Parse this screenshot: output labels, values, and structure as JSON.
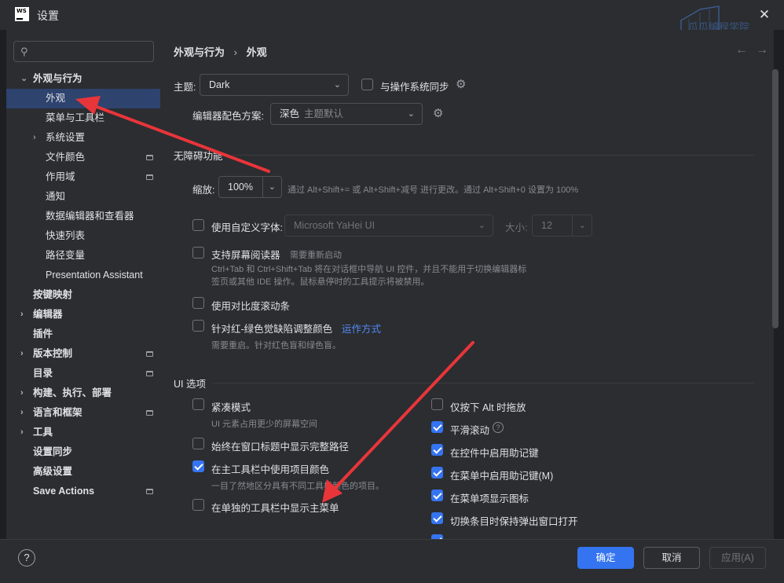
{
  "window": {
    "title": "设置",
    "logo_text": "WS",
    "watermark": "瓜瓜编程学院"
  },
  "sidebar": {
    "search_placeholder": "",
    "items": [
      {
        "label": "外观与行为",
        "expanded": true
      },
      {
        "label": "外观",
        "selected": true
      },
      {
        "label": "菜单与工具栏"
      },
      {
        "label": "系统设置"
      },
      {
        "label": "文件颜色"
      },
      {
        "label": "作用域"
      },
      {
        "label": "通知"
      },
      {
        "label": "数据编辑器和查看器"
      },
      {
        "label": "快速列表"
      },
      {
        "label": "路径变量"
      },
      {
        "label": "Presentation Assistant"
      },
      {
        "label": "按键映射"
      },
      {
        "label": "编辑器"
      },
      {
        "label": "插件"
      },
      {
        "label": "版本控制"
      },
      {
        "label": "目录"
      },
      {
        "label": "构建、执行、部署"
      },
      {
        "label": "语言和框架"
      },
      {
        "label": "工具"
      },
      {
        "label": "设置同步"
      },
      {
        "label": "高级设置"
      },
      {
        "label": "Save Actions"
      }
    ]
  },
  "breadcrumb": {
    "parent": "外观与行为",
    "separator": "›",
    "current": "外观"
  },
  "nav": {
    "back": "←",
    "forward": "→"
  },
  "theme": {
    "label": "主题:",
    "value": "Dark",
    "sync_label": "与操作系统同步",
    "sync_checked": false
  },
  "scheme": {
    "label": "编辑器配色方案:",
    "value": "深色",
    "sub": "主题默认"
  },
  "accessibility": {
    "section": "无障碍功能",
    "zoom_label": "缩放:",
    "zoom_value": "100%",
    "zoom_hint": "通过 Alt+Shift+= 或 Alt+Shift+减号 进行更改。通过 Alt+Shift+0 设置为 100%",
    "custom_font_label": "使用自定义字体:",
    "custom_font_checked": false,
    "font_value": "Microsoft YaHei UI",
    "size_label": "大小:",
    "size_value": "12",
    "screen_reader_label": "支持屏幕阅读器",
    "screen_reader_checked": false,
    "screen_reader_restart": "需要重新启动",
    "screen_reader_desc_1": "Ctrl+Tab 和 Ctrl+Shift+Tab 将在对话框中导航 UI 控件，并且不能用于切换编辑器标",
    "screen_reader_desc_2": "签页或其他 IDE 操作。鼠标悬停时的工具提示将被禁用。",
    "contrast_scroll_label": "使用对比度滚动条",
    "contrast_scroll_checked": false,
    "color_blind_label": "针对红-绿色觉缺陷调整颜色",
    "color_blind_checked": false,
    "color_blind_link": "运作方式",
    "color_blind_hint": "需要重启。针对红色盲和绿色盲。"
  },
  "ui_options": {
    "section": "UI 选项",
    "compact_label": "紧凑模式",
    "compact_checked": false,
    "compact_hint": "UI 元素占用更少的屏幕空间",
    "full_path_label": "始终在窗口标题中显示完整路径",
    "full_path_checked": false,
    "project_color_label": "在主工具栏中使用项目颜色",
    "project_color_checked": true,
    "project_color_hint": "一目了然地区分具有不同工具栏颜色的项目。",
    "main_menu_label": "在单独的工具栏中显示主菜单",
    "main_menu_checked": false,
    "alt_drag_label": "仅按下 Alt 时拖放",
    "alt_drag_checked": false,
    "smooth_scroll_label": "平滑滚动",
    "smooth_scroll_checked": true,
    "mnemonic_controls_label": "在控件中启用助记键",
    "mnemonic_controls_checked": true,
    "mnemonic_menu_label": "在菜单中启用助记键(M)",
    "mnemonic_menu_checked": true,
    "menu_icons_label": "在菜单项显示图标",
    "menu_icons_checked": true,
    "keep_popup_label": "切换条目时保持弹出窗口打开",
    "keep_popup_checked": true
  },
  "footer": {
    "help": "?",
    "ok": "确定",
    "cancel": "取消",
    "apply": "应用(A)"
  },
  "colors": {
    "accent": "#3574f0",
    "selection": "#2e436e",
    "arrow": "#e8353a"
  }
}
